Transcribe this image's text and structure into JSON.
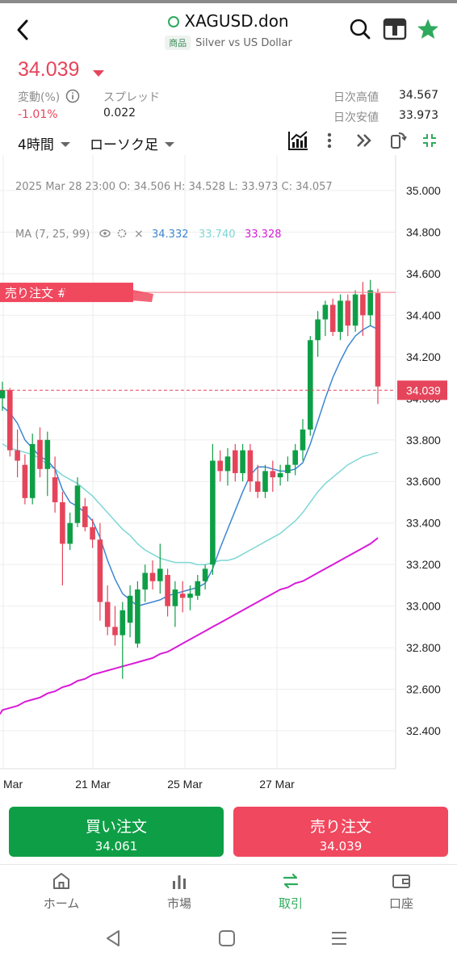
{
  "header": {
    "symbol": "XAGUSD.don",
    "category_tag": "商品",
    "description": "Silver vs US Dollar"
  },
  "quote": {
    "price": "34.039",
    "change_label": "変動(%)",
    "change_value": "-1.01%",
    "spread_label": "スプレッド",
    "spread_value": "0.022",
    "high_label": "日次高値",
    "high_value": "34.567",
    "low_label": "日次安値",
    "low_value": "33.973"
  },
  "toolbar": {
    "timeframe": "4時間",
    "chart_style": "ローソク足"
  },
  "chart_data": {
    "type": "candlestick",
    "ohlc_info": "2025 Mar 28   23:00   O: 34.506   H: 34.528   L: 33.973   C: 34.057",
    "ma": {
      "label": "MA (7, 25, 99)",
      "values": [
        "34.332",
        "33.740",
        "33.328"
      ],
      "colors": [
        "#3d86d0",
        "#7fd6d6",
        "#d81bd8"
      ]
    },
    "y_ticks": [
      "35.000",
      "34.800",
      "34.600",
      "34.400",
      "34.200",
      "34.000",
      "33.800",
      "33.600",
      "33.400",
      "33.200",
      "33.000",
      "32.800",
      "32.600",
      "32.400"
    ],
    "ylim": [
      32.3,
      35.05
    ],
    "x_ticks": [
      "Mar",
      "21 Mar",
      "25 Mar",
      "27 Mar"
    ],
    "current_price": "34.039",
    "order_line_label": "売り注文 #",
    "order_line_price": 34.51,
    "colors": {
      "up": "#0e9f46",
      "down": "#e5455b"
    },
    "candles": [
      [
        34.0,
        34.08,
        33.94,
        34.04
      ],
      [
        34.04,
        34.05,
        33.72,
        33.75
      ],
      [
        33.75,
        33.85,
        33.62,
        33.7
      ],
      [
        33.68,
        33.73,
        33.49,
        33.52
      ],
      [
        33.52,
        33.83,
        33.49,
        33.78
      ],
      [
        33.8,
        33.86,
        33.62,
        33.66
      ],
      [
        33.66,
        33.84,
        33.53,
        33.8
      ],
      [
        33.62,
        33.72,
        33.45,
        33.5
      ],
      [
        33.5,
        33.55,
        33.1,
        33.3
      ],
      [
        33.3,
        33.45,
        33.27,
        33.4
      ],
      [
        33.4,
        33.62,
        33.38,
        33.58
      ],
      [
        33.48,
        33.52,
        33.36,
        33.38
      ],
      [
        33.38,
        33.42,
        33.28,
        33.32
      ],
      [
        33.32,
        33.4,
        32.93,
        33.02
      ],
      [
        33.02,
        33.1,
        32.86,
        32.9
      ],
      [
        32.9,
        33.0,
        32.81,
        32.86
      ],
      [
        32.86,
        33.02,
        32.65,
        32.98
      ],
      [
        32.92,
        33.1,
        32.85,
        33.05
      ],
      [
        32.82,
        33.12,
        32.8,
        33.08
      ],
      [
        33.08,
        33.2,
        33.02,
        33.16
      ],
      [
        33.16,
        33.22,
        33.08,
        33.12
      ],
      [
        33.12,
        33.3,
        33.06,
        33.18
      ],
      [
        33.15,
        33.18,
        32.95,
        33.0
      ],
      [
        33.0,
        33.12,
        32.9,
        33.08
      ],
      [
        33.06,
        33.12,
        32.97,
        33.04
      ],
      [
        33.04,
        33.1,
        32.98,
        33.06
      ],
      [
        33.05,
        33.15,
        33.03,
        33.12
      ],
      [
        33.12,
        33.2,
        33.08,
        33.18
      ],
      [
        33.2,
        33.78,
        33.15,
        33.7
      ],
      [
        33.7,
        33.75,
        33.6,
        33.65
      ],
      [
        33.65,
        33.76,
        33.58,
        33.72
      ],
      [
        33.75,
        33.78,
        33.6,
        33.64
      ],
      [
        33.64,
        33.78,
        33.6,
        33.75
      ],
      [
        33.75,
        33.78,
        33.55,
        33.6
      ],
      [
        33.6,
        33.68,
        33.52,
        33.55
      ],
      [
        33.55,
        33.68,
        33.52,
        33.65
      ],
      [
        33.65,
        33.7,
        33.55,
        33.62
      ],
      [
        33.62,
        33.68,
        33.58,
        33.64
      ],
      [
        33.64,
        33.72,
        33.6,
        33.68
      ],
      [
        33.68,
        33.78,
        33.63,
        33.75
      ],
      [
        33.75,
        33.9,
        33.7,
        33.85
      ],
      [
        33.85,
        34.3,
        33.82,
        34.28
      ],
      [
        34.28,
        34.42,
        34.2,
        34.38
      ],
      [
        34.38,
        34.47,
        34.3,
        34.45
      ],
      [
        34.45,
        34.48,
        34.3,
        34.32
      ],
      [
        34.32,
        34.5,
        34.28,
        34.47
      ],
      [
        34.47,
        34.5,
        34.3,
        34.35
      ],
      [
        34.35,
        34.52,
        34.32,
        34.5
      ],
      [
        34.5,
        34.56,
        34.3,
        34.4
      ],
      [
        34.4,
        34.57,
        34.35,
        34.52
      ],
      [
        34.506,
        34.528,
        33.973,
        34.057
      ]
    ],
    "ma7": [
      33.96,
      33.93,
      33.88,
      33.8,
      33.76,
      33.72,
      33.7,
      33.66,
      33.56,
      33.5,
      33.48,
      33.45,
      33.41,
      33.33,
      33.22,
      33.13,
      33.06,
      33.03,
      33.0,
      33.01,
      33.02,
      33.03,
      33.05,
      33.06,
      33.07,
      33.08,
      33.09,
      33.11,
      33.18,
      33.28,
      33.37,
      33.46,
      33.55,
      33.63,
      33.67,
      33.67,
      33.66,
      33.65,
      33.65,
      33.66,
      33.69,
      33.78,
      33.89,
      34.0,
      34.1,
      34.18,
      34.25,
      34.3,
      34.33,
      34.35,
      34.332
    ],
    "ma25": [
      33.78,
      33.76,
      33.75,
      33.74,
      33.73,
      33.71,
      33.68,
      33.66,
      33.63,
      33.61,
      33.59,
      33.56,
      33.53,
      33.49,
      33.45,
      33.41,
      33.37,
      33.34,
      33.3,
      33.27,
      33.25,
      33.23,
      33.22,
      33.21,
      33.21,
      33.21,
      33.2,
      33.2,
      33.21,
      33.22,
      33.22,
      33.23,
      33.25,
      33.27,
      33.29,
      33.31,
      33.33,
      33.35,
      33.38,
      33.41,
      33.45,
      33.5,
      33.55,
      33.59,
      33.62,
      33.65,
      33.68,
      33.7,
      33.72,
      33.73,
      33.74
    ],
    "ma99": [
      32.5,
      32.51,
      32.52,
      32.54,
      32.55,
      32.56,
      32.58,
      32.59,
      32.61,
      32.62,
      32.64,
      32.65,
      32.67,
      32.68,
      32.69,
      32.7,
      32.71,
      32.72,
      32.73,
      32.74,
      32.75,
      32.77,
      32.78,
      32.8,
      32.82,
      32.84,
      32.86,
      32.88,
      32.9,
      32.92,
      32.94,
      32.96,
      32.98,
      33.0,
      33.02,
      33.04,
      33.06,
      33.08,
      33.09,
      33.11,
      33.12,
      33.14,
      33.16,
      33.18,
      33.2,
      33.22,
      33.24,
      33.26,
      33.28,
      33.3,
      33.328
    ]
  },
  "actions": {
    "buy_label": "買い注文",
    "buy_price": "34.061",
    "buy_color": "#0e9f46",
    "sell_label": "売り注文",
    "sell_price": "34.039",
    "sell_color": "#f0485e"
  },
  "bottom_nav": [
    {
      "label": "ホーム",
      "icon": "home-icon"
    },
    {
      "label": "市場",
      "icon": "bar-chart-icon"
    },
    {
      "label": "取引",
      "icon": "swap-icon",
      "active": true
    },
    {
      "label": "口座",
      "icon": "wallet-icon"
    }
  ]
}
